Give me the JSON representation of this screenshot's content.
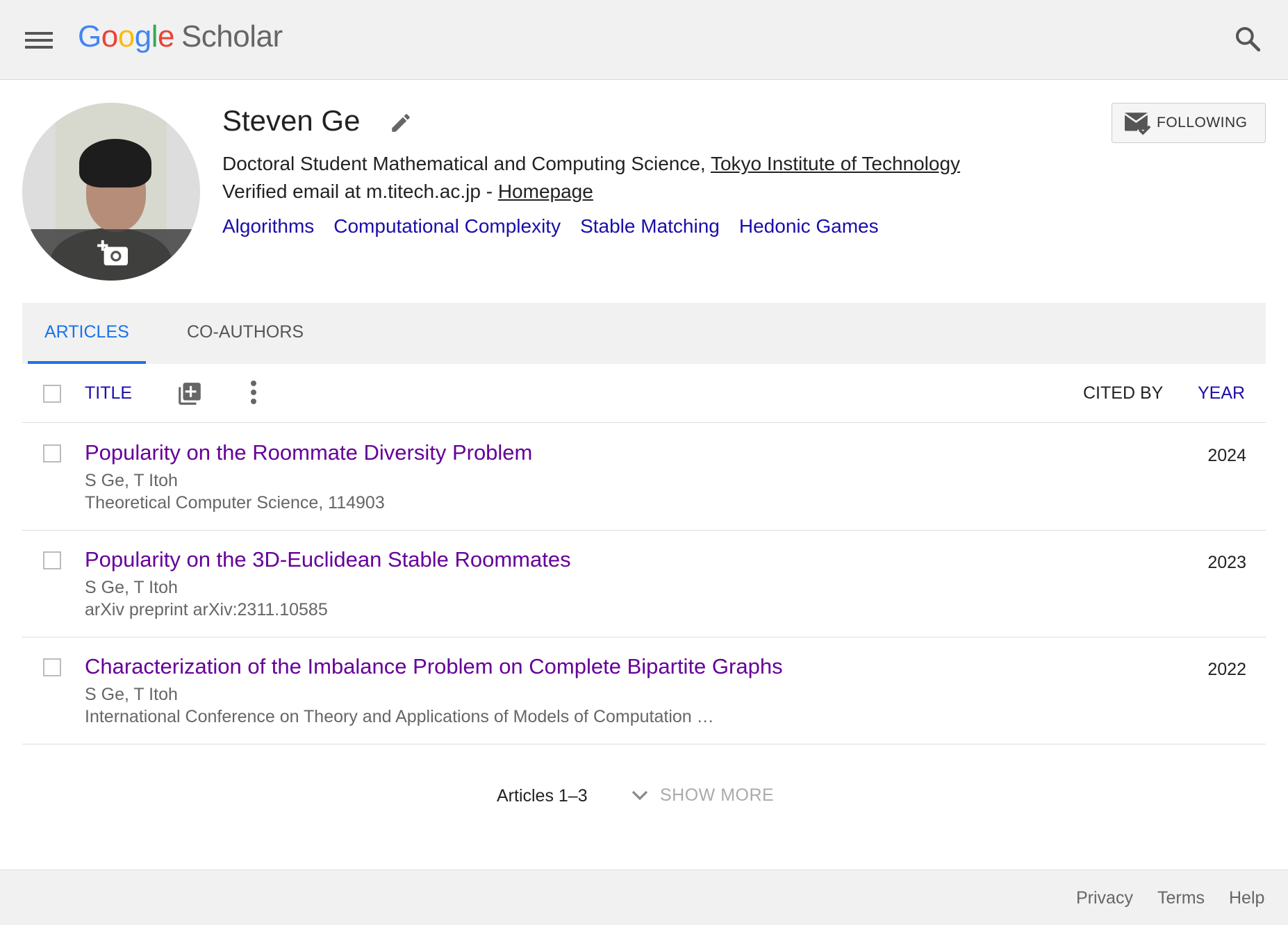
{
  "header": {
    "logo_google": "Google",
    "logo_scholar": "Scholar",
    "menu_icon": "menu-icon",
    "search_icon": "search-icon"
  },
  "profile": {
    "name": "Steven Ge",
    "affiliation_prefix": "Doctoral Student Mathematical and Computing Science, ",
    "institution": "Tokyo Institute of Technology",
    "email_prefix": "Verified email at m.titech.ac.jp - ",
    "homepage": "Homepage",
    "interests": [
      "Algorithms",
      "Computational Complexity",
      "Stable Matching",
      "Hedonic Games"
    ],
    "follow_label": "FOLLOWING"
  },
  "tabs": [
    {
      "label": "ARTICLES",
      "active": true
    },
    {
      "label": "CO-AUTHORS",
      "active": false
    }
  ],
  "columns": {
    "title": "TITLE",
    "cited_by": "CITED BY",
    "year": "YEAR"
  },
  "articles": [
    {
      "title": "Popularity on the Roommate Diversity Problem",
      "authors": "S Ge, T Itoh",
      "venue": "Theoretical Computer Science, 114903",
      "year": "2024"
    },
    {
      "title": "Popularity on the 3D-Euclidean Stable Roommates",
      "authors": "S Ge, T Itoh",
      "venue": "arXiv preprint arXiv:2311.10585",
      "year": "2023"
    },
    {
      "title": "Characterization of the Imbalance Problem on Complete Bipartite Graphs",
      "authors": "S Ge, T Itoh",
      "venue": "International Conference on Theory and Applications of Models of Computation …",
      "year": "2022"
    }
  ],
  "pager": {
    "count": "Articles 1–3",
    "show_more": "SHOW MORE"
  },
  "footer": {
    "privacy": "Privacy",
    "terms": "Terms",
    "help": "Help"
  },
  "colors": {
    "link_blue": "#1a0dab",
    "visited_purple": "#660099",
    "tab_active": "#1a73e8",
    "header_bg": "#f1f1f1"
  }
}
